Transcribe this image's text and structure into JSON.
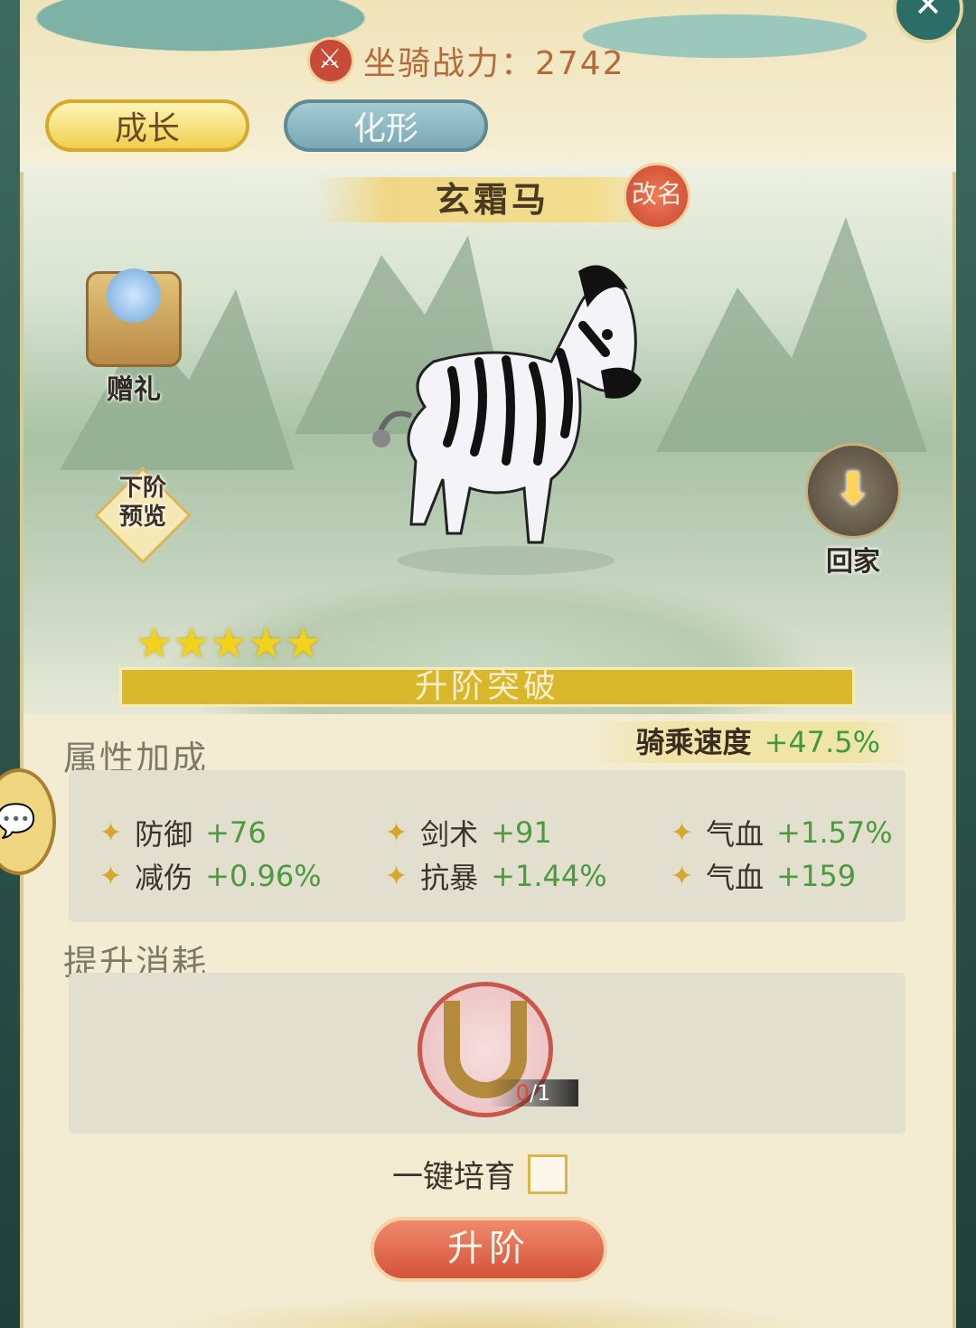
{
  "header": {
    "power_label": "坐骑战力：2742",
    "close_glyph": "✕"
  },
  "tabs": [
    {
      "label": "成长",
      "active": true
    },
    {
      "label": "化形",
      "active": false
    }
  ],
  "mount": {
    "name": "玄霜马",
    "rename_label": "改名",
    "stars": "★★★★★"
  },
  "side": {
    "gift_label": "赠礼",
    "preview_label_1": "下阶",
    "preview_label_2": "预览",
    "home_label": "回家"
  },
  "breakthrough_label": "升阶突破",
  "ride_speed": {
    "label": "骑乘速度",
    "value": "+47.5%"
  },
  "attributes": {
    "title": "属性加成",
    "items": [
      {
        "name": "防御",
        "value": "+76"
      },
      {
        "name": "剑术",
        "value": "+91"
      },
      {
        "name": "气血",
        "value": "+1.57%"
      },
      {
        "name": "减伤",
        "value": "+0.96%"
      },
      {
        "name": "抗暴",
        "value": "+1.44%"
      },
      {
        "name": "气血",
        "value": "+159"
      }
    ]
  },
  "cost": {
    "title": "提升消耗",
    "item_have": "0",
    "item_need": "/1",
    "icon": "horseshoe-icon"
  },
  "auto_label": "一键培育",
  "upgrade_label": "升阶",
  "colors": {
    "accent_gold": "#d9b72a",
    "positive": "#4b9a3e",
    "button_red": "#d4523a"
  }
}
